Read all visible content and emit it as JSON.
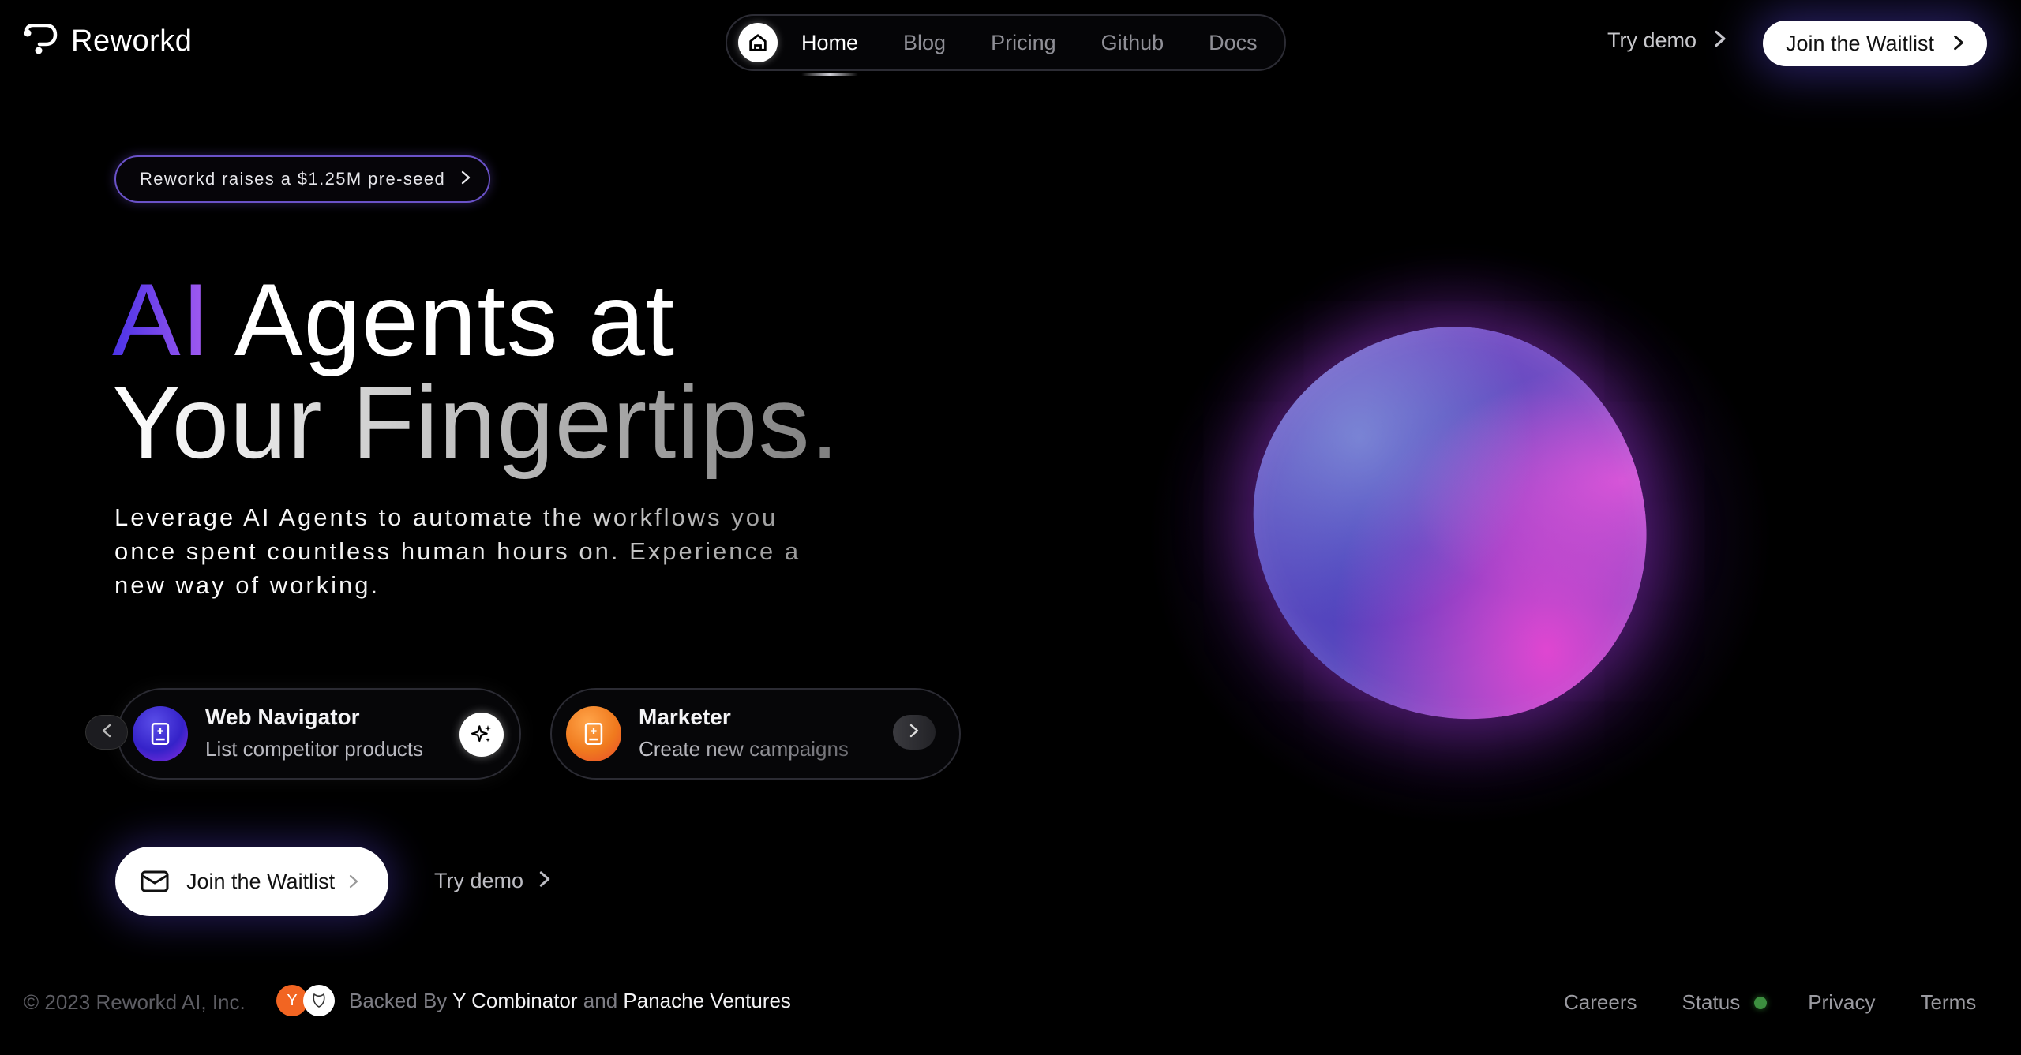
{
  "brand": {
    "name": "Reworkd"
  },
  "nav": {
    "items": [
      {
        "label": "Home",
        "active": true
      },
      {
        "label": "Blog"
      },
      {
        "label": "Pricing"
      },
      {
        "label": "Github"
      },
      {
        "label": "Docs"
      }
    ]
  },
  "header": {
    "try_demo": "Try demo",
    "join_waitlist": "Join the Waitlist"
  },
  "announcement": "Reworkd raises a $1.25M pre-seed",
  "hero": {
    "title_ai": "AI",
    "title_rest": "Agents at",
    "title_line2": "Your Fingertips.",
    "subtitle": "Leverage AI Agents to automate the workflows you once spent countless human hours on. Experience a new way of working."
  },
  "agents": [
    {
      "name": "Web Navigator",
      "description": "List competitor products",
      "icon": "book-icon",
      "color": "#4a35e0"
    },
    {
      "name": "Marketer",
      "description": "Create new campaigns",
      "icon": "book-icon",
      "color": "#f5841f"
    }
  ],
  "cta": {
    "join_waitlist": "Join the Waitlist",
    "try_demo": "Try demo"
  },
  "footer": {
    "copyright": "© 2023 Reworkd AI, Inc.",
    "yc_badge": "Y",
    "backed_by": "Backed By",
    "backer1": "Y Combinator",
    "and": "and",
    "backer2": "Panache Ventures",
    "links": {
      "careers": "Careers",
      "status": "Status",
      "privacy": "Privacy",
      "terms": "Terms"
    },
    "status_color": "#3c8e3f"
  }
}
